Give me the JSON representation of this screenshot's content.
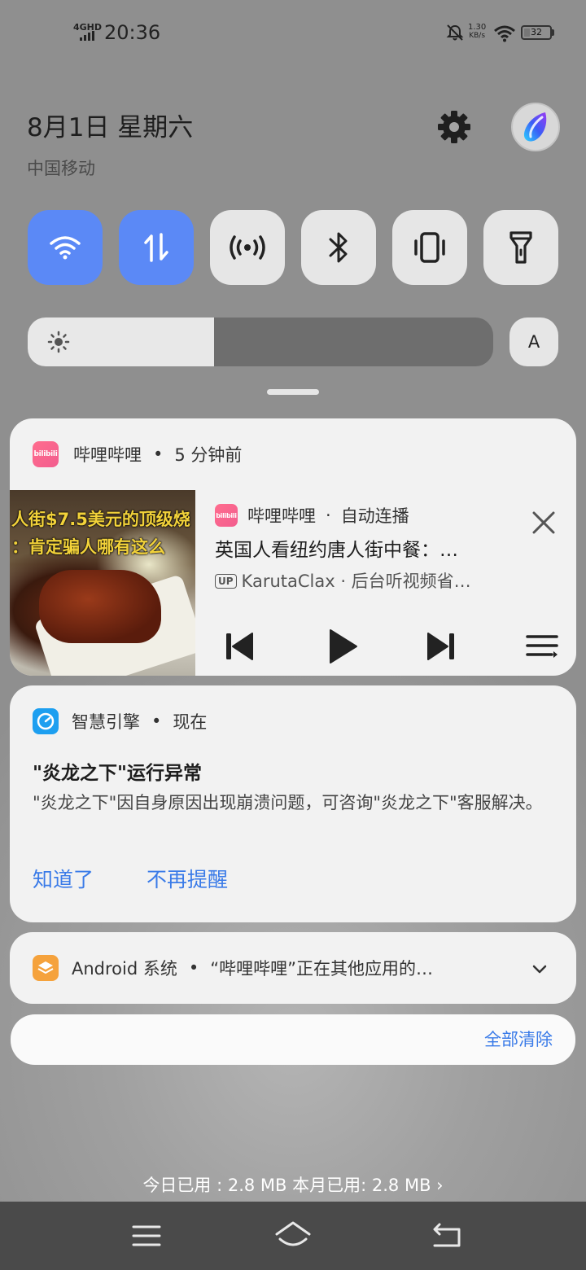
{
  "status_bar": {
    "network_type": "4GHD",
    "time": "20:36",
    "net_speed_value": "1.30",
    "net_speed_unit": "KB/s",
    "battery_level": "32",
    "battery_fraction": 0.32
  },
  "header": {
    "date": "8月1日 星期六",
    "carrier": "中国移动"
  },
  "quick_tiles": [
    {
      "icon": "wifi-icon",
      "active": true
    },
    {
      "icon": "mobile-data-icon",
      "active": true
    },
    {
      "icon": "hotspot-icon",
      "active": false
    },
    {
      "icon": "bluetooth-icon",
      "active": false
    },
    {
      "icon": "vibrate-icon",
      "active": false
    },
    {
      "icon": "flashlight-icon",
      "active": false
    }
  ],
  "brightness": {
    "level_fraction": 0.4,
    "auto_label": "A"
  },
  "notifications": {
    "bilibili": {
      "app_name": "哔哩哔哩",
      "time": "5 分钟前",
      "icon_text": "bilibili",
      "thumbnail_caption_1": "人街$7.5美元的顶级烧",
      "thumbnail_caption_2": "：肯定骗人哪有这么",
      "media_app_name": "哔哩哔哩",
      "media_mode": "自动连播",
      "title": "英国人看纽约唐人街中餐：…",
      "up_badge": "UP",
      "subtitle": "KarutaClax · 后台听视频省…"
    },
    "smart_engine": {
      "app_name": "智慧引擎",
      "time": "现在",
      "title": "\"炎龙之下\"运行异常",
      "body": "\"炎龙之下\"因自身原因出现崩溃问题，可咨询\"炎龙之下\"客服解决。",
      "action_ok": "知道了",
      "action_never": "不再提醒"
    },
    "android_system": {
      "app_name": "Android 系统",
      "summary": "“哔哩哔哩”正在其他应用的…"
    }
  },
  "clear_all_label": "全部清除",
  "data_usage": "今日已用 : 2.8 MB 本月已用: 2.8 MB ›",
  "colors": {
    "accent_blue": "#3a7be8",
    "tile_active": "#5b89f6",
    "bilibili_pink": "#f25d8e"
  }
}
